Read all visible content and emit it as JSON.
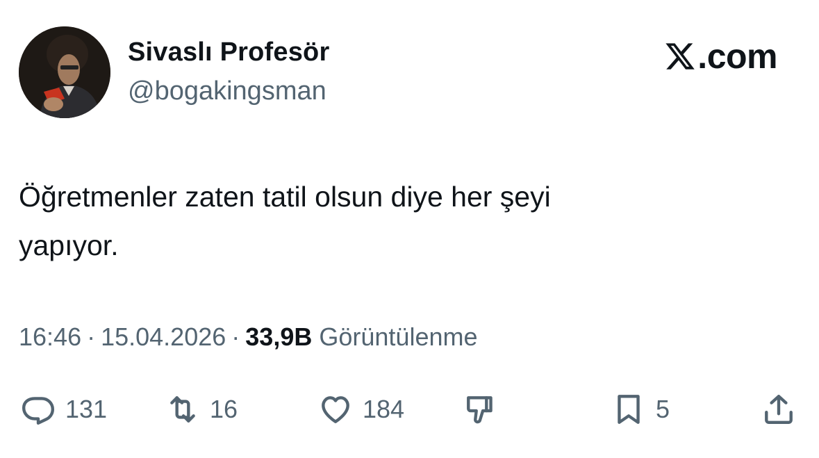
{
  "author": {
    "display_name": "Sivaslı Profesör",
    "handle": "@bogakingsman"
  },
  "brand": {
    "suffix": ".com",
    "icon": "x-logo-icon"
  },
  "tweet": {
    "text": "Öğretmenler zaten tatil olsun diye her şeyi\nyapıyor.",
    "time": "16:46",
    "date": "15.04.2026",
    "separator": "·",
    "views_count": "33,9B",
    "views_label": "Görüntülenme"
  },
  "actions": {
    "reply": {
      "icon": "reply-icon",
      "count": "131"
    },
    "retweet": {
      "icon": "retweet-icon",
      "count": "16"
    },
    "like": {
      "icon": "heart-icon",
      "count": "184"
    },
    "dislike": {
      "icon": "thumbs-down-icon"
    },
    "bookmark": {
      "icon": "bookmark-icon",
      "count": "5"
    },
    "share": {
      "icon": "share-icon"
    }
  },
  "colors": {
    "text": "#0f1419",
    "secondary": "#536471",
    "background": "#ffffff"
  }
}
